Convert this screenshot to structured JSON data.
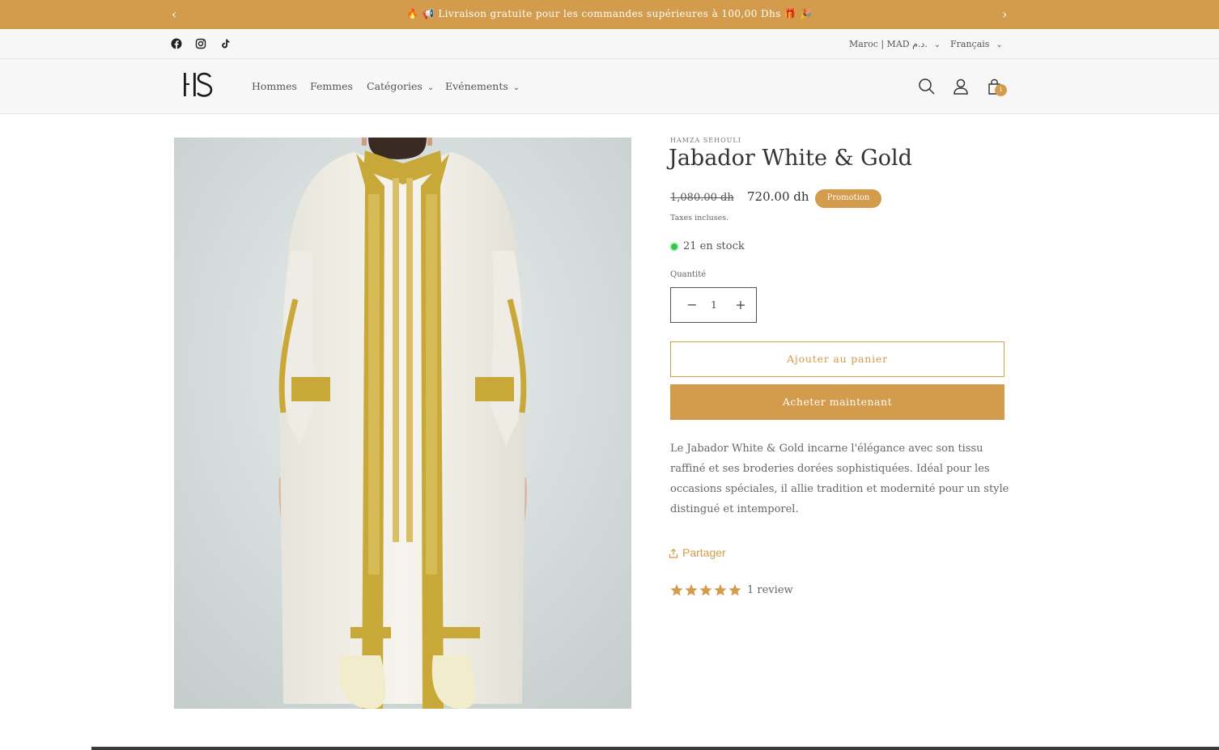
{
  "announcement": {
    "text": "🔥 📢 Livraison gratuite pour les commandes supérieures à 100,00 Dhs 🎁 🎉",
    "prev_label": "‹",
    "next_label": "›"
  },
  "utility": {
    "social": [
      "facebook-icon",
      "instagram-icon",
      "tiktok-icon"
    ],
    "country": "Maroc | MAD د.م.",
    "language": "Français"
  },
  "header": {
    "logo_icon": "hs-monogram-logo",
    "nav": [
      {
        "label": "Hommes",
        "has_dropdown": false
      },
      {
        "label": "Femmes",
        "has_dropdown": false
      },
      {
        "label": "Catégories",
        "has_dropdown": true
      },
      {
        "label": "Evénements",
        "has_dropdown": true
      }
    ],
    "icons": [
      "search-icon",
      "account-icon",
      "cart-icon"
    ],
    "cart_count": "1"
  },
  "product": {
    "vendor": "HAMZA SEHOULI",
    "title": "Jabador White & Gold",
    "compare_price": "1,080.00 dh",
    "price": "720.00 dh",
    "badge": "Promotion",
    "taxes": "Taxes incluses.",
    "stock": "21 en stock",
    "quantity_label": "Quantité",
    "quantity_value": "1",
    "add_to_cart": "Ajouter au panier",
    "buy_now": "Acheter maintenant",
    "description": "Le Jabador White & Gold incarne l'élégance avec son tissu raffiné et ses broderies dorées sophistiquées. Idéal pour les occasions spéciales, il allie tradition et modernité pour un style distingué et intemporel.",
    "share": "Partager",
    "rating": 5,
    "rating_max": 5,
    "review_text": "1 review"
  },
  "colors": {
    "accent": "#d39b4c",
    "stock_dot": "#2ec84a",
    "header_bg": "#f7f7f7"
  }
}
